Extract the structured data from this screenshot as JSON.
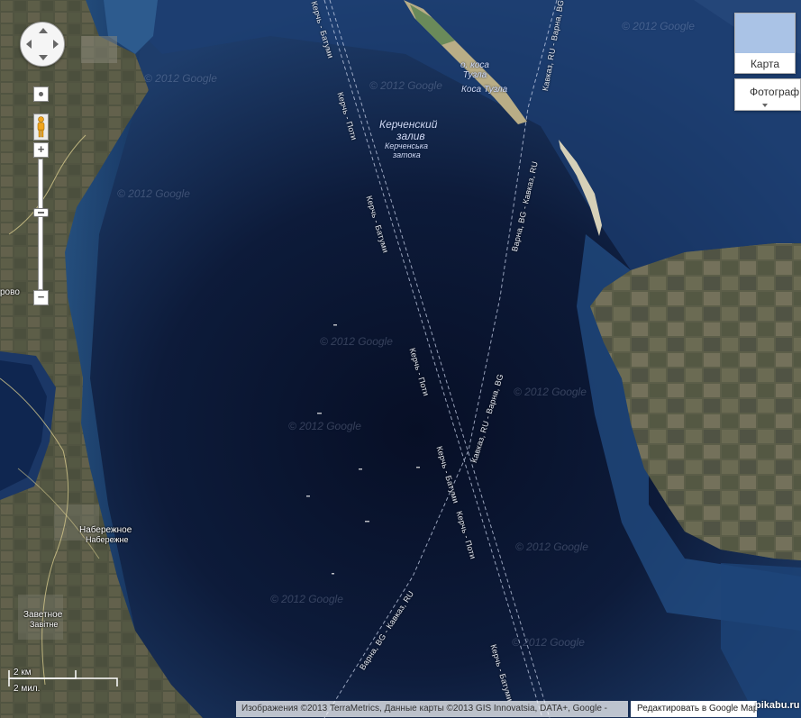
{
  "map": {
    "type": "satellite",
    "place_labels": {
      "kosa_tuzla_ua": "о. коса\nТузла",
      "kosa_tuzla_ru": "Коса Тузла",
      "kerch_bay_ru_1": "Керченский",
      "kerch_bay_ru_2": "залив",
      "kerch_bay_ua_1": "Керченська",
      "kerch_bay_ua_2": "затока",
      "naberezhnoe_ru": "Набережное",
      "naberezhnoe_ua": "Набережне",
      "zavetnoe_ru": "Заветное",
      "zavetnoe_ua": "Завітне",
      "edge_fragment": "рово"
    },
    "routes": {
      "kerch_batumi": "Керчь - Батуми",
      "kerch_poti": "Керчь - Поти",
      "varna_kavkaz": "Варна, BG - Кавказ, RU",
      "kavkaz_varna": "Кавказ, RU - Варна, BG"
    },
    "watermark_text": "© 2012 Google"
  },
  "controls": {
    "zoom_in": "+",
    "zoom_out": "−",
    "map_type_map": "Карта",
    "map_type_satellite": "Фотограф"
  },
  "scale": {
    "metric": "2 км",
    "imperial": "2 мил."
  },
  "footer": {
    "attribution": "Изображения ©2013 TerraMetrics, Данные карты ©2013 GIS Innovatsia, DATA+, Google -",
    "edit_link": "Редактировать в Google Map",
    "site_watermark": "pikabu.ru"
  }
}
